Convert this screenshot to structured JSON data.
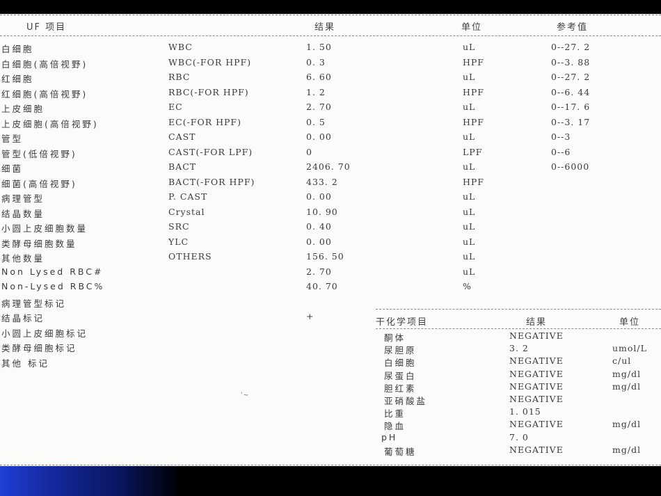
{
  "uf_table": {
    "headers": {
      "item": "UF 项目",
      "result": "结果",
      "unit": "单位",
      "reference": "参考值"
    },
    "rows": [
      {
        "name": "白细胞",
        "code": "WBC",
        "result": "1. 50",
        "unit": "uL",
        "reference": "0--27. 2"
      },
      {
        "name": "白细胞(高倍视野)",
        "code": "WBC(-FOR HPF)",
        "result": "0. 3",
        "unit": "HPF",
        "reference": "0--3. 88"
      },
      {
        "name": "红细胞",
        "code": "RBC",
        "result": "6. 60",
        "unit": "uL",
        "reference": "0--27. 2"
      },
      {
        "name": "红细胞(高倍视野)",
        "code": "RBC(-FOR HPF)",
        "result": "1. 2",
        "unit": "HPF",
        "reference": "0--6. 44"
      },
      {
        "name": "上皮细胞",
        "code": "EC",
        "result": "2. 70",
        "unit": "uL",
        "reference": "0--17. 6"
      },
      {
        "name": "上皮细胞(高倍视野)",
        "code": "EC(-FOR HPF)",
        "result": "0. 5",
        "unit": "HPF",
        "reference": "0--3. 17"
      },
      {
        "name": "管型",
        "code": "CAST",
        "result": "0. 00",
        "unit": "uL",
        "reference": "0--3"
      },
      {
        "name": "管型(低倍视野)",
        "code": "CAST(-FOR LPF)",
        "result": "0",
        "unit": "LPF",
        "reference": "0--6"
      },
      {
        "name": "细菌",
        "code": "BACT",
        "result": "2406. 70",
        "unit": "uL",
        "reference": "0--6000"
      },
      {
        "name": "细菌(高倍视野)",
        "code": "BACT(-FOR HPF)",
        "result": "433. 2",
        "unit": "HPF",
        "reference": ""
      },
      {
        "name": "病理管型",
        "code": "P. CAST",
        "result": "0. 00",
        "unit": "uL",
        "reference": ""
      },
      {
        "name": "结晶数量",
        "code": "Crystal",
        "result": "10. 90",
        "unit": "uL",
        "reference": ""
      },
      {
        "name": "小圆上皮细胞数量",
        "code": "SRC",
        "result": "0. 40",
        "unit": "uL",
        "reference": ""
      },
      {
        "name": "类酵母细胞数量",
        "code": "YLC",
        "result": "0. 00",
        "unit": "uL",
        "reference": ""
      },
      {
        "name": "其他数量",
        "code": "OTHERS",
        "result": "156. 50",
        "unit": "uL",
        "reference": ""
      },
      {
        "name": "Non Lysed RBC#",
        "code": "",
        "result": "2. 70",
        "unit": "uL",
        "reference": ""
      },
      {
        "name": "Non-Lysed RBC%",
        "code": "",
        "result": "40. 70",
        "unit": "%",
        "reference": ""
      },
      {
        "name": "病理管型标记",
        "code": "",
        "result": "",
        "unit": "",
        "reference": ""
      },
      {
        "name": "结晶标记",
        "code": "",
        "result": "+",
        "unit": "",
        "reference": ""
      },
      {
        "name": "小圆上皮细胞标记",
        "code": "",
        "result": "",
        "unit": "",
        "reference": ""
      },
      {
        "name": "类酵母细胞标记",
        "code": "",
        "result": "",
        "unit": "",
        "reference": ""
      },
      {
        "name": "其他 标记",
        "code": "",
        "result": "",
        "unit": "",
        "reference": ""
      }
    ]
  },
  "chem_table": {
    "headers": {
      "item": "干化学项目",
      "result": "结果",
      "unit": "单位"
    },
    "rows": [
      {
        "name": "酮体",
        "result": "NEGATIVE",
        "unit": ""
      },
      {
        "name": "尿胆原",
        "result": "3. 2",
        "unit": "umol/L"
      },
      {
        "name": "白细胞",
        "result": "NEGATIVE",
        "unit": "c/ul"
      },
      {
        "name": "尿蛋白",
        "result": "NEGATIVE",
        "unit": "mg/dl"
      },
      {
        "name": "胆红素",
        "result": "NEGATIVE",
        "unit": "mg/dl"
      },
      {
        "name": "亚硝酸盐",
        "result": "NEGATIVE",
        "unit": ""
      },
      {
        "name": "比重",
        "result": "1. 015",
        "unit": ""
      },
      {
        "name": "隐血",
        "result": "NEGATIVE",
        "unit": "mg/dl"
      },
      {
        "name": "pH",
        "result": "7. 0",
        "unit": ""
      },
      {
        "name": "葡萄糖",
        "result": "NEGATIVE",
        "unit": "mg/dl"
      }
    ]
  },
  "theme": {
    "bottom_bar_accent": "#1f3fd6",
    "paper": "#fbfbf9"
  }
}
